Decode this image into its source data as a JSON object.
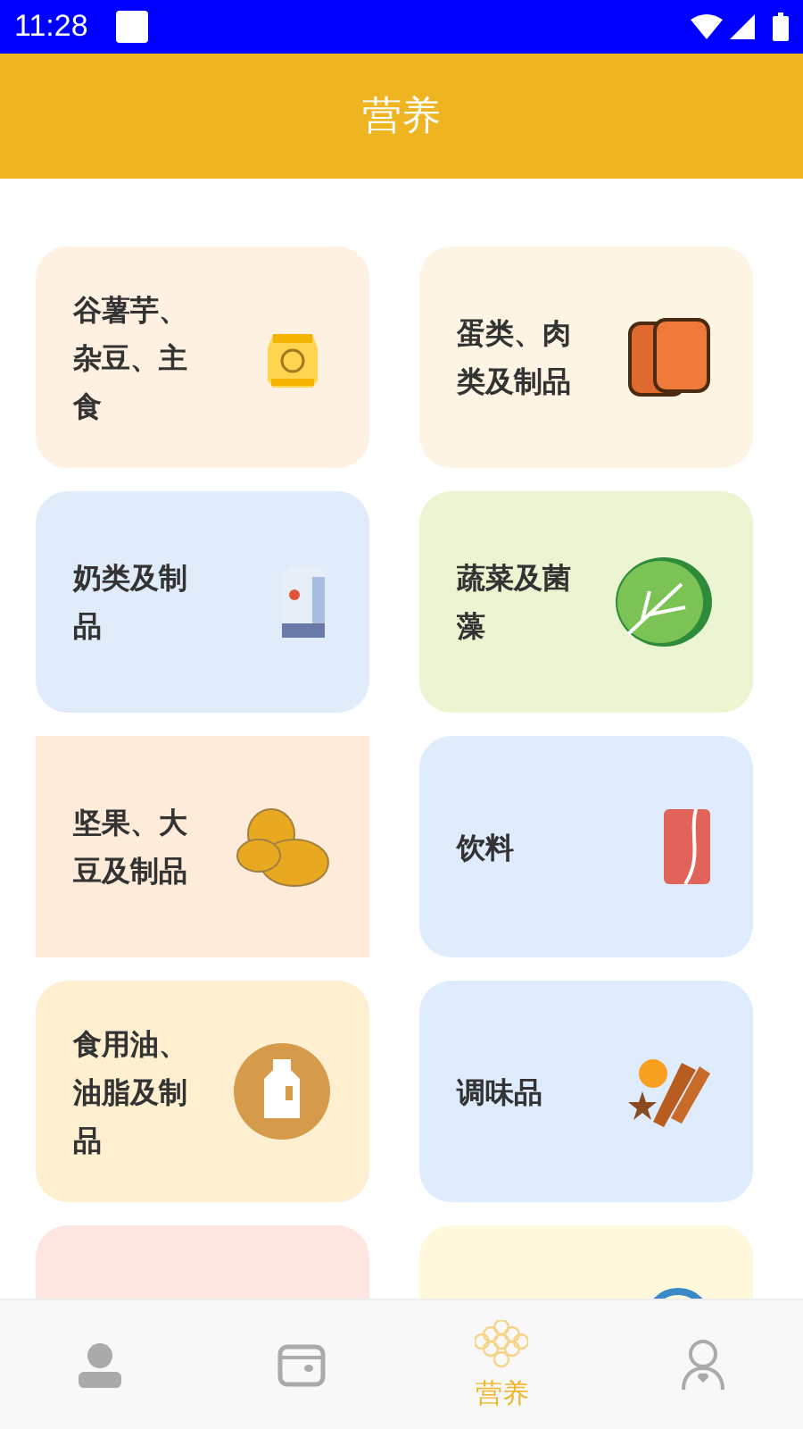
{
  "status_bar": {
    "time": "11:28"
  },
  "header": {
    "title": "营养"
  },
  "categories": [
    {
      "label": "谷薯芋、杂豆、主食",
      "kind": "grain-bag",
      "color": "#fef1e2",
      "selected": false
    },
    {
      "label": "蛋类、肉类及制品",
      "kind": "meat",
      "color": "#fef4e4",
      "selected": false
    },
    {
      "label": "奶类及制品",
      "kind": "milk",
      "color": "#e0ecf9",
      "selected": false
    },
    {
      "label": "蔬菜及菌藻",
      "kind": "cabbage",
      "color": "#ecf5d2",
      "selected": false
    },
    {
      "label": "坚果、大豆及制品",
      "kind": "beans",
      "color": "#feebd9",
      "selected": true
    },
    {
      "label": "饮料",
      "kind": "can",
      "color": "#dfecfd",
      "selected": false
    },
    {
      "label": "食用油、油脂及制品",
      "kind": "oil",
      "color": "#feefd0",
      "selected": false
    },
    {
      "label": "调味品",
      "kind": "spices",
      "color": "#dfecfd",
      "selected": false
    },
    {
      "kind": "blank",
      "color": "#fde6e0",
      "selected": false
    },
    {
      "kind": "ring",
      "color": "#fef9dc",
      "selected": false
    }
  ],
  "nav": [
    {
      "kind": "person",
      "selected": false
    },
    {
      "kind": "wallet",
      "selected": false
    },
    {
      "kind": "honeycomb",
      "label": "营养",
      "selected": true
    },
    {
      "kind": "user",
      "selected": false
    }
  ]
}
